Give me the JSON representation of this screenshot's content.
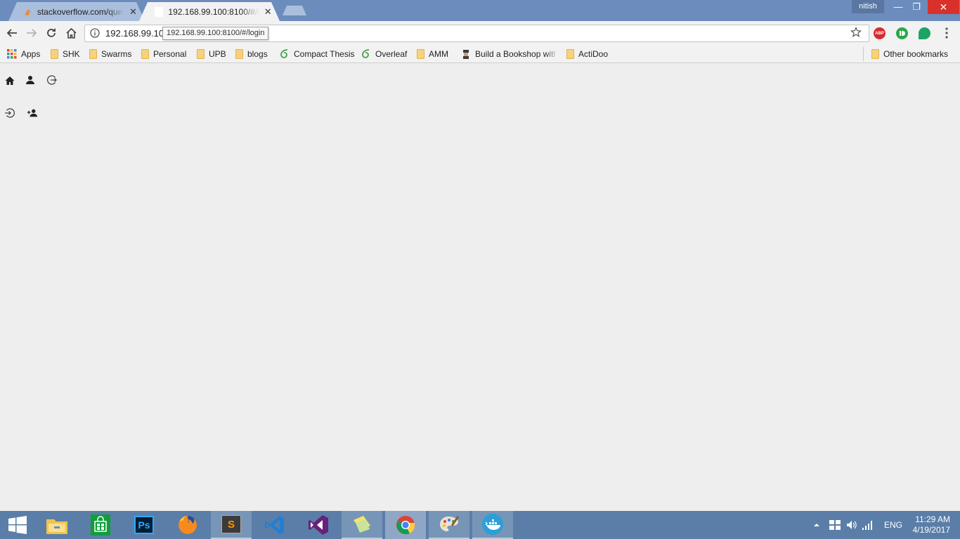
{
  "window": {
    "user": "nitish",
    "minimize_glyph": "—",
    "restore_glyph": "❐",
    "close_glyph": "✕"
  },
  "tabs": [
    {
      "title": "stackoverflow.com/quest",
      "favicon": "stackoverflow-icon",
      "active": false,
      "close_glyph": "✕"
    },
    {
      "title": "192.168.99.100:8100/#/lo",
      "favicon": "blank-page-icon",
      "active": true,
      "close_glyph": "✕"
    }
  ],
  "omnibox": {
    "url": "192.168.99.10",
    "tooltip": "192.168.99.100:8100/#/login"
  },
  "extensions": [
    {
      "name": "adblock-plus-icon",
      "label": "ABP",
      "color": "#d62b2b"
    },
    {
      "name": "grammarly-icon",
      "color": "#2aa84a"
    },
    {
      "name": "hangouts-icon",
      "color": "#1ea362"
    }
  ],
  "bookmarks": [
    {
      "label": "Apps",
      "icon": "apps-grid-icon"
    },
    {
      "label": "SHK",
      "icon": "folder-icon"
    },
    {
      "label": "Swarms",
      "icon": "folder-icon"
    },
    {
      "label": "Personal",
      "icon": "folder-icon"
    },
    {
      "label": "UPB",
      "icon": "folder-icon"
    },
    {
      "label": "blogs",
      "icon": "folder-icon"
    },
    {
      "label": "Compact Thesis",
      "icon": "overleaf-icon"
    },
    {
      "label": "Overleaf",
      "icon": "overleaf-icon"
    },
    {
      "label": "AMM",
      "icon": "folder-icon"
    },
    {
      "label": "Build a Bookshop with",
      "icon": "bookshop-icon"
    },
    {
      "label": "ActiDoo",
      "icon": "folder-icon"
    }
  ],
  "other_bookmarks": "Other bookmarks",
  "page": {
    "nav_icons": [
      "home-icon",
      "person-icon",
      "logout-icon"
    ],
    "action_icons": [
      "login-icon",
      "person-add-icon"
    ]
  },
  "taskbar": {
    "apps": [
      "file-explorer-icon",
      "store-icon",
      "photoshop-icon",
      "firefox-icon",
      "sublime-text-icon",
      "vscode-icon",
      "visual-studio-icon",
      "sticky-notes-icon",
      "chrome-icon",
      "paint-icon",
      "docker-icon"
    ],
    "ps_label": "Ps",
    "sublime_label": "S",
    "language": "ENG",
    "time": "11:29 AM",
    "date": "4/19/2017"
  },
  "colors": {
    "titlebar": "#6b8cbc",
    "taskbar": "#5a7ea8",
    "page_background": "#eeeeee",
    "close_red": "#d9302c"
  }
}
